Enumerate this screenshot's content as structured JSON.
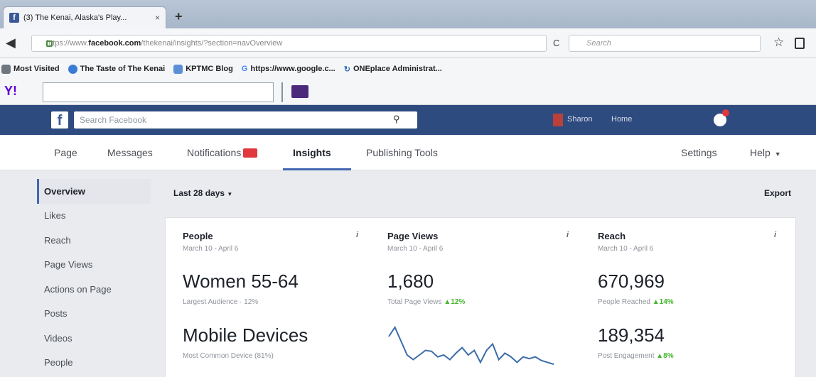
{
  "browser": {
    "tab_title": "(3) The Kenai, Alaska's Play...",
    "tab_close": "×",
    "new_tab": "+",
    "url_prefix": "https://www.",
    "url_domain": "facebook.com",
    "url_path": "/thekenai/insights/?section=navOverview",
    "search_placeholder": "Search",
    "bookmarks": [
      {
        "label": "Most Visited",
        "icon_color": "#6f7680"
      },
      {
        "label": "The Taste of The Kenai",
        "icon_color": "#3a7bd5"
      },
      {
        "label": "KPTMC Blog",
        "icon_color": "#5b8fd6"
      },
      {
        "label": "https://www.google.c...",
        "icon_color": "#4285f4"
      },
      {
        "label": "ONEplace Administrat...",
        "icon_color": "#2a6fb8"
      }
    ],
    "yahoo_logo": "Y!"
  },
  "fb": {
    "search_placeholder": "Search Facebook",
    "user_name": "Sharon",
    "home_label": "Home"
  },
  "page_nav": {
    "page": "Page",
    "messages": "Messages",
    "notifications": "Notifications",
    "insights": "Insights",
    "publishing_tools": "Publishing Tools",
    "settings": "Settings",
    "help": "Help"
  },
  "sidebar": {
    "items": [
      "Overview",
      "Likes",
      "Reach",
      "Page Views",
      "Actions on Page",
      "Posts",
      "Videos",
      "People"
    ]
  },
  "main": {
    "date_range": "Last 28 days",
    "export_label": "Export",
    "people": {
      "title": "People",
      "date": "March 10 - April 6",
      "primary_value": "Women 55-64",
      "primary_label": "Largest Audience · 12%",
      "secondary_value": "Mobile Devices",
      "secondary_label": "Most Common Device (81%)"
    },
    "page_views": {
      "title": "Page Views",
      "date": "March 10 - April 6",
      "value": "1,680",
      "label": "Total Page Views",
      "change": "▲12%",
      "sparkline": [
        50,
        60,
        45,
        30,
        25,
        30,
        35,
        34,
        28,
        30,
        25,
        32,
        38,
        30,
        35,
        22,
        35,
        42,
        25,
        32,
        28,
        22,
        28,
        26,
        28,
        24,
        22,
        20
      ]
    },
    "reach": {
      "title": "Reach",
      "date": "March 10 - April 6",
      "primary_value": "670,969",
      "primary_label": "People Reached",
      "primary_change": "▲14%",
      "secondary_value": "189,354",
      "secondary_label": "Post Engagement",
      "secondary_change": "▲8%"
    },
    "info_glyph": "i"
  }
}
